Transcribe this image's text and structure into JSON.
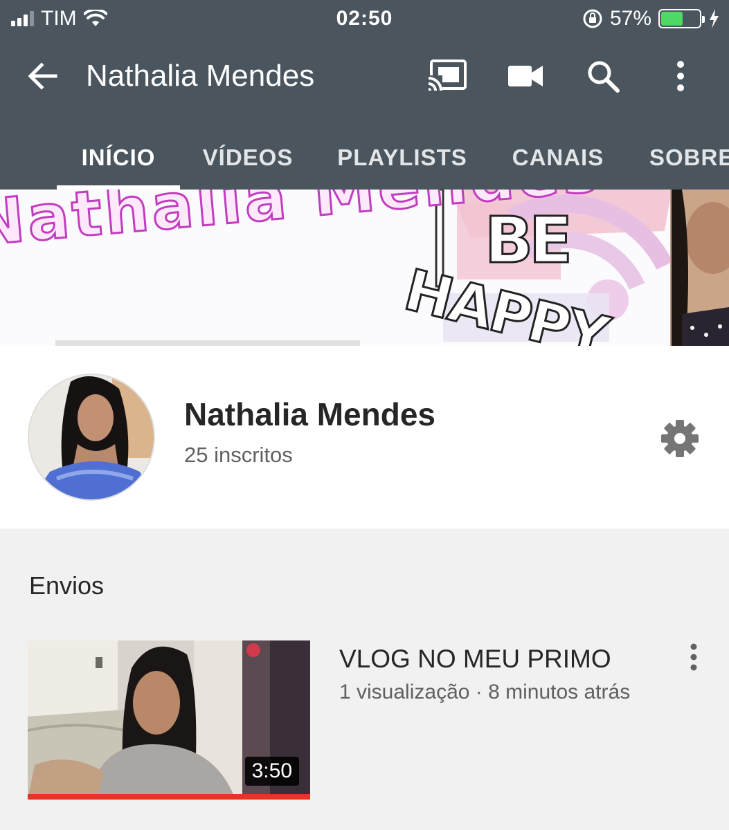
{
  "status_bar": {
    "carrier": "TIM",
    "time": "02:50",
    "battery_percent": "57%",
    "battery_level": 0.57,
    "battery_color": "#4cd964"
  },
  "app_bar": {
    "title": "Nathalia Mendes",
    "background_color": "#4b555e",
    "icons": [
      "back-arrow-icon",
      "cast-icon",
      "video-camera-icon",
      "search-icon",
      "more-vert-icon"
    ]
  },
  "tabs": [
    {
      "label": "INÍCIO",
      "active": true
    },
    {
      "label": "VÍDEOS",
      "active": false
    },
    {
      "label": "PLAYLISTS",
      "active": false
    },
    {
      "label": "CANAIS",
      "active": false
    },
    {
      "label": "SOBRE",
      "active": false
    }
  ],
  "banner": {
    "text": "Nathalia Mendes",
    "overlay_text_1": "BE",
    "overlay_text_2": "HAPPY"
  },
  "channel": {
    "name": "Nathalia Mendes",
    "subscribers": "25 inscritos"
  },
  "uploads": {
    "section_title": "Envios",
    "videos": [
      {
        "title": "VLOG NO MEU PRIMO",
        "meta": "1 visualização · 8 minutos atrás",
        "duration": "3:50",
        "watched_fraction": 1.0
      }
    ]
  }
}
